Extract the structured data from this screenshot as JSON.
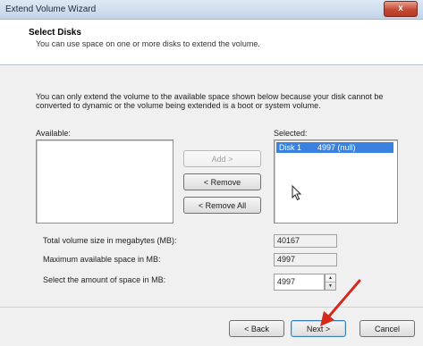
{
  "window": {
    "title": "Extend Volume Wizard",
    "close_glyph": "x"
  },
  "header": {
    "title": "Select Disks",
    "subtitle": "You can use space on one or more disks to extend the volume."
  },
  "description": "You can only extend the volume to the available space shown below because your disk cannot be converted to dynamic or the volume being extended is a boot or system volume.",
  "available": {
    "label": "Available:",
    "items": []
  },
  "selected": {
    "label": "Selected:",
    "items": [
      {
        "disk": "Disk 1",
        "size": "4997 (null)"
      }
    ]
  },
  "buttons": {
    "add": "Add >",
    "remove": "< Remove",
    "remove_all": "< Remove All",
    "back": "< Back",
    "next": "Next >",
    "cancel": "Cancel"
  },
  "fields": {
    "total_size": {
      "label": "Total volume size in megabytes (MB):",
      "value": "40167"
    },
    "max_space": {
      "label": "Maximum available space in MB:",
      "value": "4997"
    },
    "select_amount": {
      "label": "Select the amount of space in MB:",
      "value": "4997"
    }
  },
  "colors": {
    "annotation_arrow": "#d42a1e",
    "selection": "#3b82e0"
  }
}
